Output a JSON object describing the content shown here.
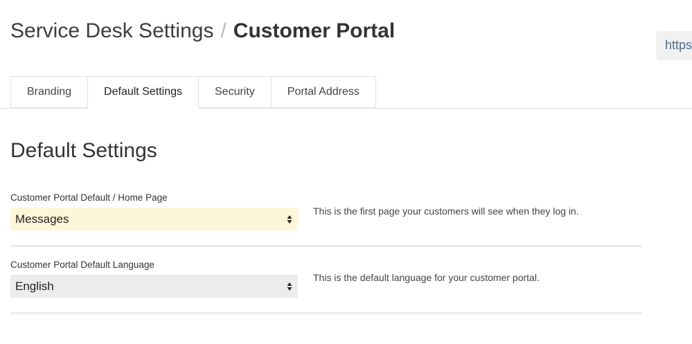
{
  "header": {
    "parent": "Service Desk Settings",
    "separator": "/",
    "current": "Customer Portal",
    "url_chip": "https"
  },
  "tabs": [
    {
      "label": "Branding",
      "active": false
    },
    {
      "label": "Default Settings",
      "active": true
    },
    {
      "label": "Security",
      "active": false
    },
    {
      "label": "Portal Address",
      "active": false
    }
  ],
  "main": {
    "title": "Default Settings",
    "fields": [
      {
        "label": "Customer Portal Default / Home Page",
        "value": "Messages",
        "help": "This is the first page your customers will see when they log in.",
        "background": "#fdf7d8"
      },
      {
        "label": "Customer Portal Default Language",
        "value": "English",
        "help": "This is the default language for your customer portal.",
        "background": "#ebeced"
      }
    ]
  },
  "icons": {
    "select_arrows": "up-down-arrows-icon"
  }
}
